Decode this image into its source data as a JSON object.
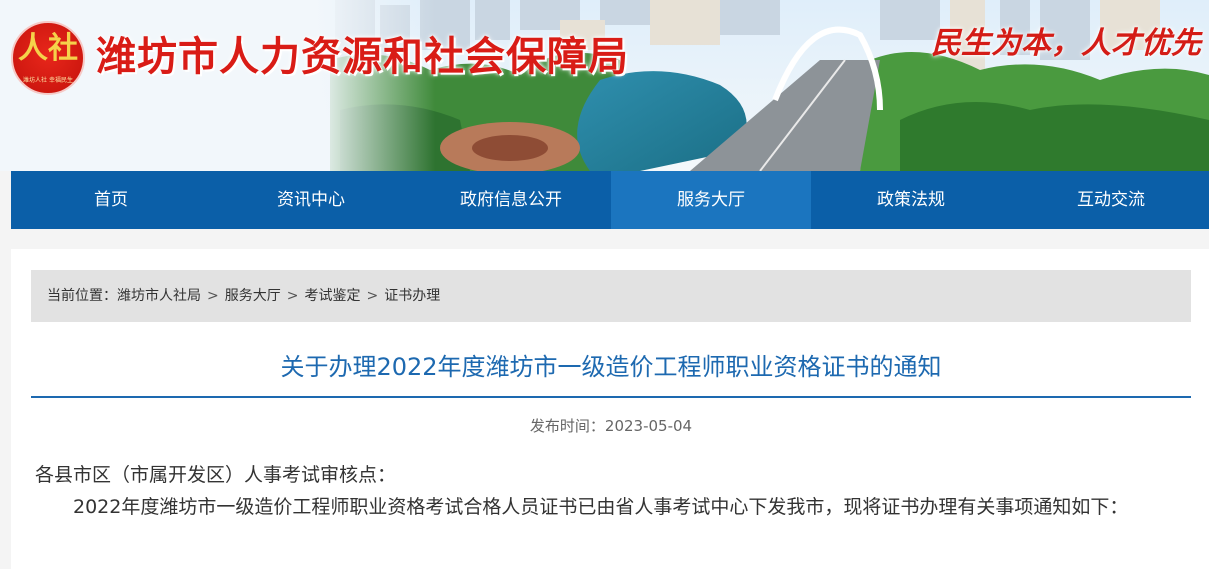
{
  "header": {
    "logo_mark": "人社",
    "logo_caption": "潍坊人社 幸福民生",
    "site_title": "潍坊市人力资源和社会保障局",
    "slogan": "民生为本，人才优先"
  },
  "nav": {
    "items": [
      "首页",
      "资讯中心",
      "政府信息公开",
      "服务大厅",
      "政策法规",
      "互动交流"
    ],
    "active_index": 3
  },
  "breadcrumb": {
    "prefix": "当前位置：",
    "items": [
      "潍坊市人社局",
      "服务大厅",
      "考试鉴定",
      "证书办理"
    ],
    "separator": ">"
  },
  "article": {
    "title": "关于办理2022年度潍坊市一级造价工程师职业资格证书的通知",
    "publish_label": "发布时间：",
    "publish_date": "2023-05-04",
    "salutation": "各县市区（市属开发区）人事考试审核点：",
    "paragraph1": "2022年度潍坊市一级造价工程师职业资格考试合格人员证书已由省人事考试中心下发我市，现将证书办理有关事项通知如下："
  },
  "colors": {
    "brand_red": "#d91c16",
    "nav_blue": "#0b5fa8",
    "nav_active": "#1b75bf",
    "title_blue": "#1d69b0"
  }
}
